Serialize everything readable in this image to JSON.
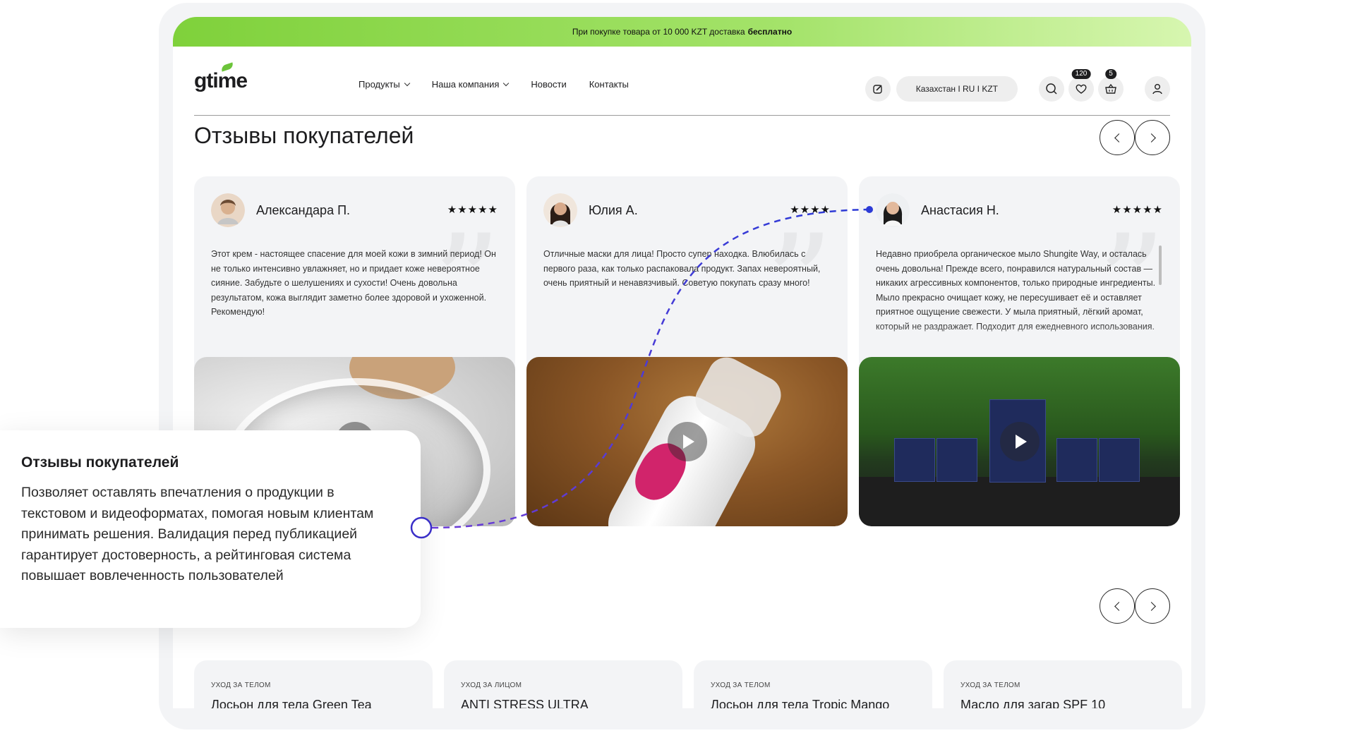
{
  "promo": {
    "text": "При покупке товара от 10 000 KZT доставка",
    "bold": "бесплатно"
  },
  "logo": "gtime",
  "nav": [
    {
      "label": "Продукты",
      "dropdown": true
    },
    {
      "label": "Наша компания",
      "dropdown": true
    },
    {
      "label": "Новости",
      "dropdown": false
    },
    {
      "label": "Контакты",
      "dropdown": false
    }
  ],
  "header": {
    "region": "Казахстан I RU I KZT",
    "wishlist_count": "120",
    "cart_count": "5",
    "icons": [
      "edit-icon",
      "search-icon",
      "heart-icon",
      "basket-icon",
      "user-icon"
    ]
  },
  "reviews": {
    "title": "Отзывы покупателей",
    "items": [
      {
        "name": "Александара П.",
        "stars": "★★★★★",
        "rating": 5,
        "text": "Этот крем - настоящее спасение для моей кожи в зимний период! Он не только интенсивно увлажняет, но и придает коже невероятное сияние. Забудьте о шелушениях и сухости! Очень довольна результатом, кожа выглядит заметно более здоровой и ухоженной. Рекомендую!"
      },
      {
        "name": "Юлия А.",
        "stars": "★★★★",
        "rating": 4,
        "text": "Отличные маски для лица! Просто супер находка. Влюбилась с первого раза, как только распаковала продукт. Запах невероятный, очень приятный и ненавязчивый. Советую покупать сразу много!"
      },
      {
        "name": "Анастасия Н.",
        "stars": "★★★★★",
        "rating": 5,
        "text": "Недавно приобрела органическое мыло Shungite Way, и осталась очень довольна! Прежде всего, понравился натуральный состав — никаких агрессивных компонентов, только природные ингредиенты. Мыло прекрасно очищает кожу, не пересушивает её и оставляет приятное ощущение свежести. У мыла приятный, лёгкий аромат, который не раздражает. Подходит для ежедневного использования."
      }
    ]
  },
  "products": [
    {
      "category": "УХОД ЗА ТЕЛОМ",
      "name": "Лосьон для тела Green Tea"
    },
    {
      "category": "УХОД ЗА ЛИЦОМ",
      "name": "ANTI STRESS ULTRA"
    },
    {
      "category": "УХОД ЗА ТЕЛОМ",
      "name": "Лосьон для тела Tropic Mango"
    },
    {
      "category": "УХОД ЗА ТЕЛОМ",
      "name": "Масло для загар SPF 10"
    }
  ],
  "callout": {
    "title": "Отзывы покупателей",
    "text": "Позволяет оставлять впечатления о продукции в текстовом и видеоформатах, помогая новым клиентам принимать решения. Валидация перед публикацией гарантирует достоверность, а рейтинговая система повышает вовлеченность пользователей"
  },
  "colors": {
    "accent_green": "#7fd13b",
    "connector_blue": "#2c3bd6",
    "connector_purple": "#6a3bd6"
  }
}
